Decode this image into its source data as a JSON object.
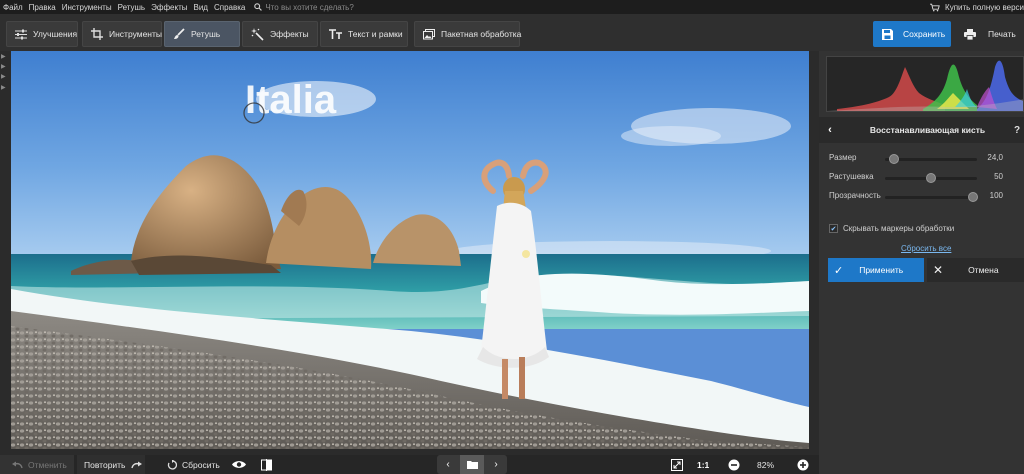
{
  "menu": [
    "Файл",
    "Правка",
    "Инструменты",
    "Ретушь",
    "Эффекты",
    "Вид",
    "Справка"
  ],
  "search": {
    "placeholder": "Что вы хотите сделать?",
    "icon": "search-icon"
  },
  "buy_label": "Купить полную верси",
  "tabs": [
    {
      "label": "Улучшения",
      "icon": "sliders-icon"
    },
    {
      "label": "Инструменты",
      "icon": "crop-icon"
    },
    {
      "label": "Ретушь",
      "icon": "brush-icon",
      "active": true
    },
    {
      "label": "Эффекты",
      "icon": "magic-wand-icon"
    },
    {
      "label": "Текст и рамки",
      "icon": "text-icon"
    },
    {
      "label": "Пакетная обработка",
      "icon": "batch-icon"
    }
  ],
  "toolbar": {
    "save_label": "Сохранить",
    "print_label": "Печать"
  },
  "canvas": {
    "overlay_text": "Italia"
  },
  "panel": {
    "title": "Восстанавливающая кисть",
    "help": "?",
    "sliders": [
      {
        "label": "Размер",
        "value": "24,0",
        "fraction": 0.05
      },
      {
        "label": "Растушевка",
        "value": "50",
        "fraction": 0.5
      },
      {
        "label": "Прозрачность",
        "value": "100",
        "fraction": 1.0
      }
    ],
    "checkbox": {
      "label": "Скрывать маркеры обработки",
      "checked": true
    },
    "reset_all": "Сбросить все",
    "apply_label": "Применить",
    "cancel_label": "Отмена"
  },
  "bottom": {
    "undo_label": "Отменить",
    "redo_label": "Повторить",
    "reset_label": "Сбросить",
    "one_to_one": "1:1",
    "zoom": "82%"
  },
  "colors": {
    "accent": "#1e78c8",
    "active_tab": "#4b5563",
    "panel_bg": "#333333"
  }
}
